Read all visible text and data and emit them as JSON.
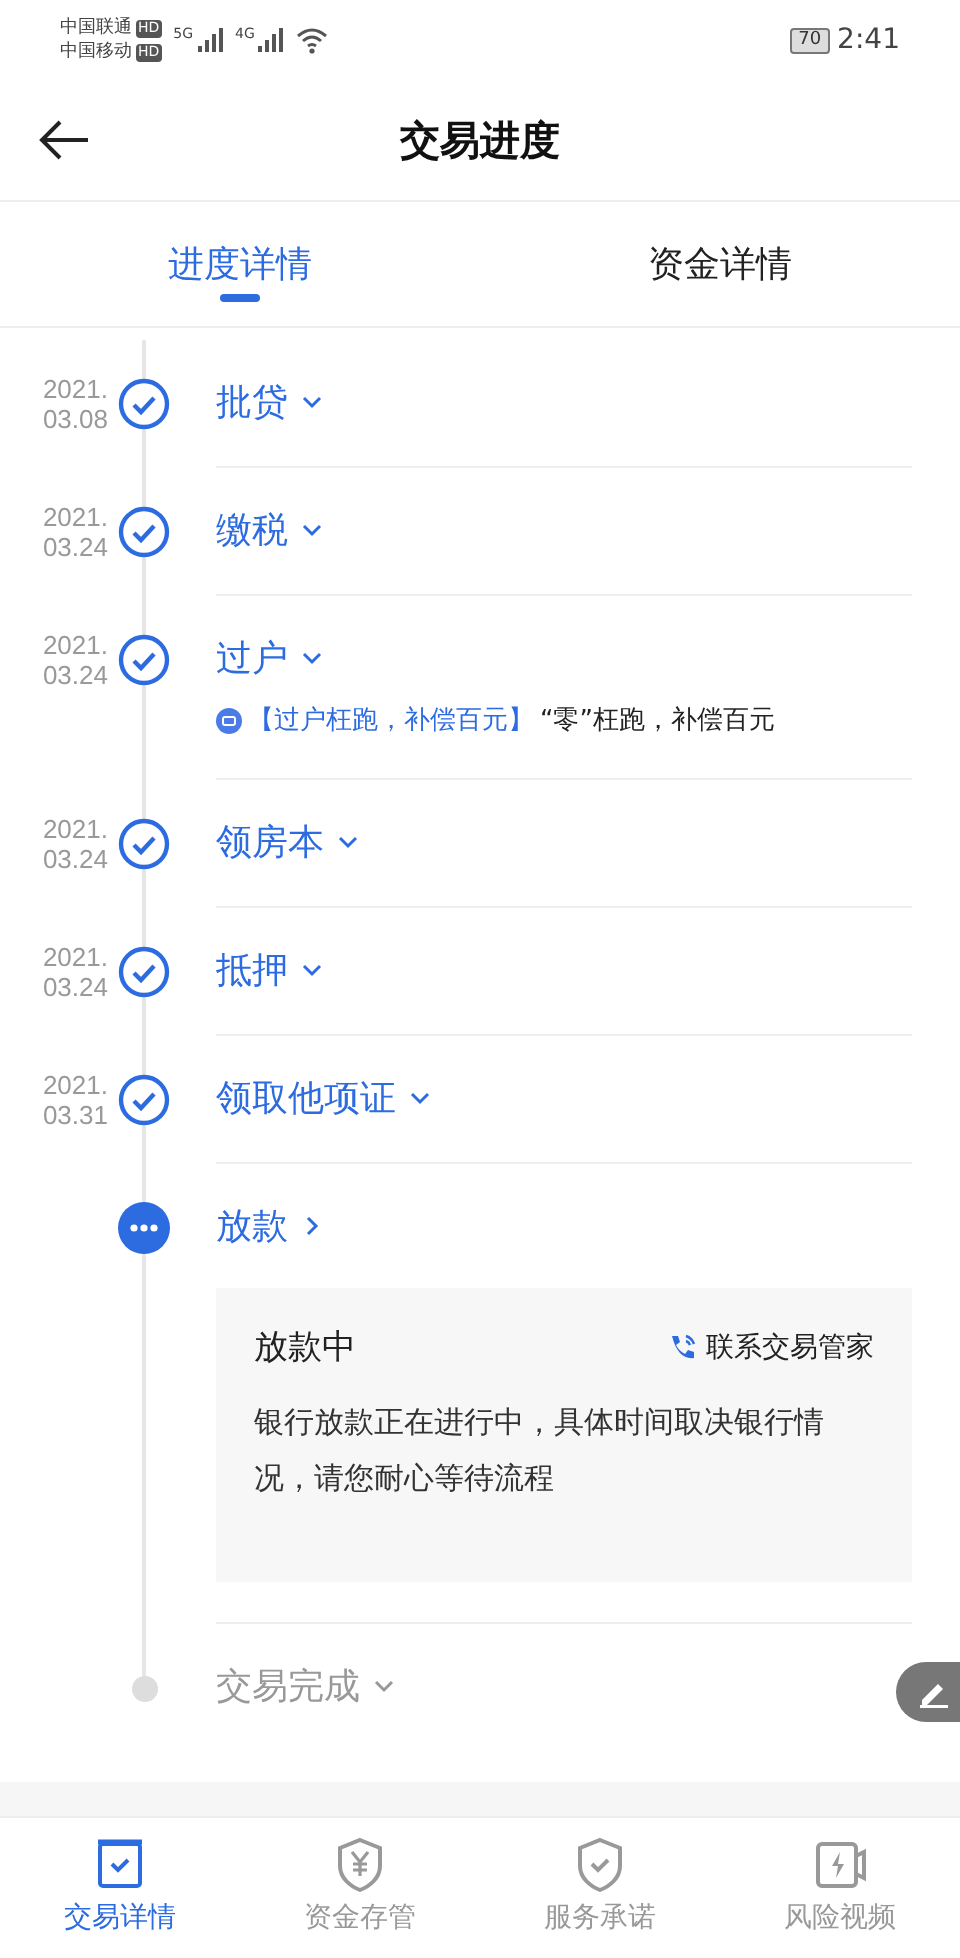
{
  "status_bar": {
    "carriers": [
      {
        "name": "中国联通",
        "badge": "HD"
      },
      {
        "name": "中国移动",
        "badge": "HD"
      }
    ],
    "networks": [
      "5G",
      "4G"
    ],
    "battery": "70",
    "time": "2:41"
  },
  "header": {
    "title": "交易进度"
  },
  "tabs": [
    {
      "label": "进度详情",
      "selected": true
    },
    {
      "label": "资金详情",
      "selected": false
    }
  ],
  "steps": [
    {
      "date": [
        "2021.",
        "03.08"
      ],
      "title": "批贷",
      "kind": "done",
      "link": false
    },
    {
      "date": [
        "2021.",
        "03.24"
      ],
      "title": "缴税",
      "kind": "done",
      "link": false
    },
    {
      "date": [
        "2021.",
        "03.24"
      ],
      "title": "过户",
      "kind": "done",
      "link": false,
      "note": {
        "tag": "【过户枉跑，补偿百元】",
        "text": "“零”枉跑，补偿百元"
      }
    },
    {
      "date": [
        "2021.",
        "03.24"
      ],
      "title": "领房本",
      "kind": "done",
      "link": false
    },
    {
      "date": [
        "2021.",
        "03.24"
      ],
      "title": "抵押",
      "kind": "done",
      "link": false
    },
    {
      "date": [
        "2021.",
        "03.31"
      ],
      "title": "领取他项证",
      "kind": "done",
      "link": false
    },
    {
      "title": "放款",
      "kind": "current",
      "link": true,
      "detail": {
        "title": "放款中",
        "contact": "联系交易管家",
        "text": "银行放款正在进行中，具体时间取决银行情况，请您耐心等待流程"
      }
    },
    {
      "title": "交易完成",
      "kind": "pending",
      "link": false
    }
  ],
  "bottom_nav": [
    {
      "label": "交易详情",
      "kind": "box",
      "selected": true
    },
    {
      "label": "资金存管",
      "kind": "yuan",
      "selected": false
    },
    {
      "label": "服务承诺",
      "kind": "shield",
      "selected": false
    },
    {
      "label": "风险视频",
      "kind": "video",
      "selected": false
    }
  ]
}
